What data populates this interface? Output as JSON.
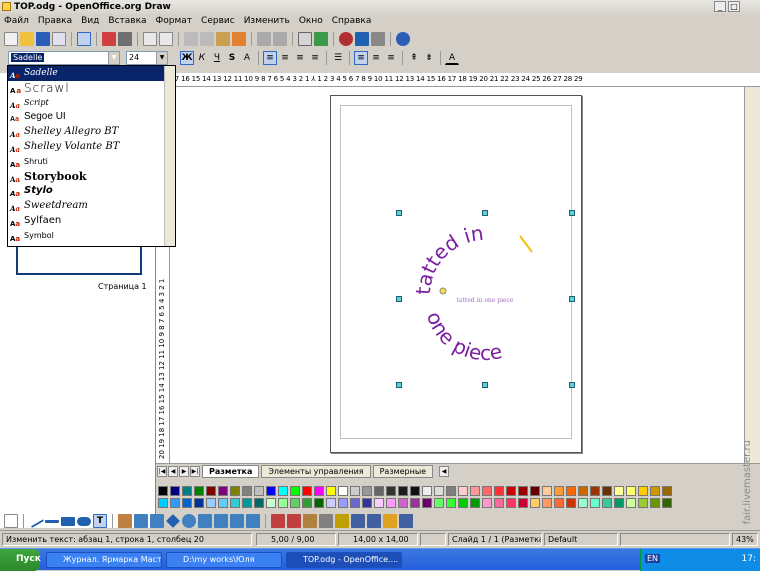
{
  "window": {
    "title": "TOP.odg - OpenOffice.org Draw"
  },
  "menu": [
    "Файл",
    "Правка",
    "Вид",
    "Вставка",
    "Формат",
    "Сервис",
    "Изменить",
    "Окно",
    "Справка"
  ],
  "format_bar": {
    "font_value": "Sadelle",
    "font_size": "24"
  },
  "font_list": [
    "Sadelle",
    "Scrawl",
    "Script",
    "Segoe UI",
    "Shelley Allegro BT",
    "Shelley Volante BT",
    "Shruti",
    "Storybook",
    "Stylo",
    "Sweetdream",
    "Sylfaen",
    "Symbol"
  ],
  "slides_panel": {
    "page_label": "Страница 1"
  },
  "ruler": {
    "ticks": "18 17 16 15 14 13 12 11 10 9 8 7 6 5 4 3 2 1 ⅄ 1 2 3 4 5 6 7 8 9 10 11 12 13 14 15 16 17 18 19 20 21 22 23 24 25 26 27 28 29"
  },
  "vruler": {
    "ticks": "20 19 18 17 16 15 14 13 12 11 10 9 8 7 6 5 4 3 2 1"
  },
  "canvas": {
    "circle_text_top": "tatted in",
    "circle_text_bottom": "one piece",
    "center_text": "tatted in one piece"
  },
  "tabs": [
    "Разметка",
    "Элементы управления",
    "Размерные"
  ],
  "status": {
    "action": "Изменить текст: абзац 1, строка 1, столбец 20",
    "position": "5,00 / 9,00",
    "size": "14,00 x 14,00",
    "slide": "Слайд 1 / 1 (Разметка)",
    "layout": "Default",
    "zoom": "43%"
  },
  "taskbar": {
    "start": "Пуск",
    "tasks": [
      "Журнал. Ярмарка Маст...",
      "D:\\my works\\Юля",
      "TOP.odg - OpenOffice...."
    ],
    "lang": "EN",
    "time": "17:"
  },
  "watermark": "fair.livemaster.ru",
  "colors": {
    "text": "#7a1fa0",
    "accent": "#f4c20d",
    "handle": "#5ad2d2",
    "selection": "#0a246a"
  }
}
